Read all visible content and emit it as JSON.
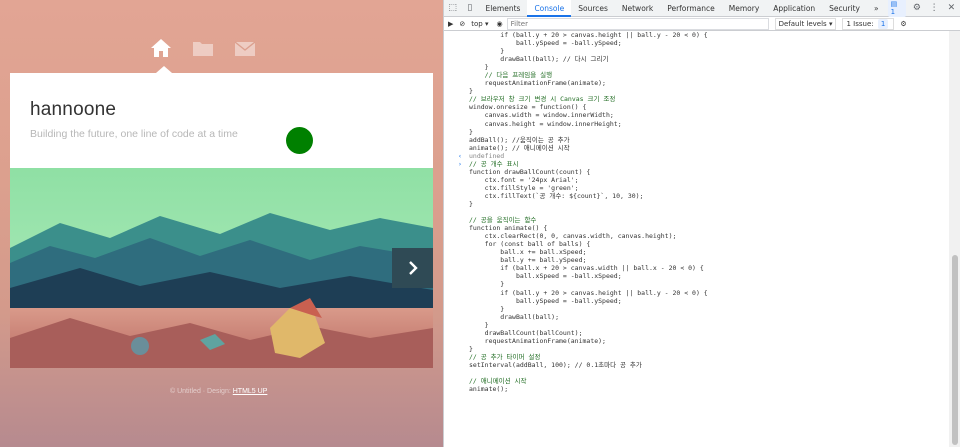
{
  "page": {
    "nav_icons": [
      "home-icon",
      "folder-icon",
      "mail-icon"
    ],
    "site_title": "hannoone",
    "tagline": "Building the future, one line of code at a time",
    "footer_text": "© Untitled · Design:",
    "footer_link": "HTML5 UP",
    "colors": {
      "ball": "#008000",
      "nav_active": "#ffffff"
    }
  },
  "devtools": {
    "tabs": [
      "Elements",
      "Console",
      "Sources",
      "Network",
      "Performance",
      "Memory",
      "Application",
      "Security"
    ],
    "active_tab": "Console",
    "more": "»",
    "messages_badge": "1",
    "context": "top",
    "filter_placeholder": "Filter",
    "default_levels": "Default levels",
    "issues": "1 Issue:",
    "issues_count": "1",
    "lines": [
      {
        "t": "        if (ball.y + 20 > canvas.height || ball.y - 20 < 0) {"
      },
      {
        "t": "            ball.ySpeed = -ball.ySpeed;"
      },
      {
        "t": "        }"
      },
      {
        "t": "        drawBall(ball); // 다시 그리기"
      },
      {
        "t": "    }"
      },
      {
        "t": "    // 다음 프레임을 실행"
      },
      {
        "t": "    requestAnimationFrame(animate);"
      },
      {
        "t": "}"
      },
      {
        "t": "// 브라우저 창 크기 변경 시 Canvas 크기 조정"
      },
      {
        "t": "window.onresize = function() {"
      },
      {
        "t": "    canvas.width = window.innerWidth;"
      },
      {
        "t": "    canvas.height = window.innerHeight;"
      },
      {
        "t": "}"
      },
      {
        "t": "addBall(); //움직이는 공 추가"
      },
      {
        "t": "animate(); // 애니메이션 시작"
      },
      {
        "t": "undefined",
        "m": "‹",
        "c": "undef"
      },
      {
        "t": "// 공 개수 표시",
        "m": "›"
      },
      {
        "t": "function drawBallCount(count) {"
      },
      {
        "t": "    ctx.font = '24px Arial';"
      },
      {
        "t": "    ctx.fillStyle = 'green';"
      },
      {
        "t": "    ctx.fillText(`공 개수: ${count}`, 10, 30);"
      },
      {
        "t": "}"
      },
      {
        "t": ""
      },
      {
        "t": "// 공을 움직이는 함수"
      },
      {
        "t": "function animate() {"
      },
      {
        "t": "    ctx.clearRect(0, 0, canvas.width, canvas.height);"
      },
      {
        "t": "    for (const ball of balls) {"
      },
      {
        "t": "        ball.x += ball.xSpeed;"
      },
      {
        "t": "        ball.y += ball.ySpeed;"
      },
      {
        "t": "        if (ball.x + 20 > canvas.width || ball.x - 20 < 0) {"
      },
      {
        "t": "            ball.xSpeed = -ball.xSpeed;"
      },
      {
        "t": "        }"
      },
      {
        "t": "        if (ball.y + 20 > canvas.height || ball.y - 20 < 0) {"
      },
      {
        "t": "            ball.ySpeed = -ball.ySpeed;"
      },
      {
        "t": "        }"
      },
      {
        "t": "        drawBall(ball);"
      },
      {
        "t": "    }"
      },
      {
        "t": "    drawBallCount(ballCount);"
      },
      {
        "t": "    requestAnimationFrame(animate);"
      },
      {
        "t": "}"
      },
      {
        "t": "// 공 추가 타이머 설정"
      },
      {
        "t": "setInterval(addBall, 100); // 0.1초마다 공 추가"
      },
      {
        "t": ""
      },
      {
        "t": "// 애니메이션 시작"
      },
      {
        "t": "animate();"
      }
    ]
  }
}
